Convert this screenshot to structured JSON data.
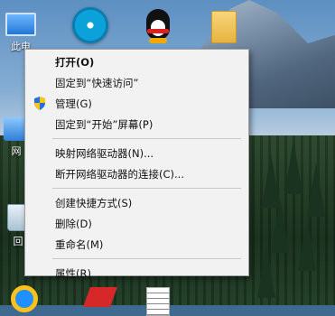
{
  "desktop": {
    "icons": [
      {
        "label": "此电"
      },
      {
        "label": "网"
      },
      {
        "label": "回"
      }
    ]
  },
  "context_menu": {
    "groups": [
      [
        {
          "label": "打开(O)",
          "bold": true
        },
        {
          "label": "固定到“快速访问”"
        },
        {
          "label": "管理(G)",
          "icon": "shield-icon"
        },
        {
          "label": "固定到“开始”屏幕(P)"
        }
      ],
      [
        {
          "label": "映射网络驱动器(N)..."
        },
        {
          "label": "断开网络驱动器的连接(C)..."
        }
      ],
      [
        {
          "label": "创建快捷方式(S)"
        },
        {
          "label": "删除(D)"
        },
        {
          "label": "重命名(M)"
        }
      ],
      [
        {
          "label": "属性(R)"
        }
      ]
    ]
  },
  "colors": {
    "menu_bg": "#f2f2f2",
    "menu_border": "#a0a0a0",
    "shield_blue": "#2a6fd6",
    "shield_yellow": "#f5c518"
  }
}
